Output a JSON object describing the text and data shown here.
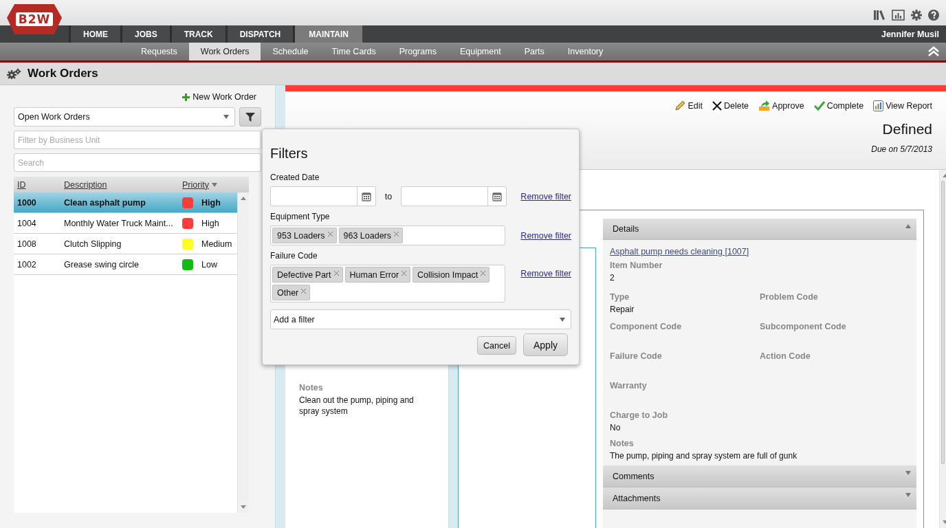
{
  "app": {
    "logo": "B2W",
    "user": "Jennifer Musil"
  },
  "main_nav": [
    {
      "label": "HOME",
      "selected": false
    },
    {
      "label": "JOBS",
      "selected": false
    },
    {
      "label": "TRACK",
      "selected": false
    },
    {
      "label": "DISPATCH",
      "selected": false
    },
    {
      "label": "MAINTAIN",
      "selected": true
    }
  ],
  "sub_nav": [
    {
      "label": "Requests",
      "selected": false
    },
    {
      "label": "Work Orders",
      "selected": true
    },
    {
      "label": "Schedule",
      "selected": false
    },
    {
      "label": "Time Cards",
      "selected": false
    },
    {
      "label": "Programs",
      "selected": false
    },
    {
      "label": "Equipment",
      "selected": false
    },
    {
      "label": "Parts",
      "selected": false
    },
    {
      "label": "Inventory",
      "selected": false
    }
  ],
  "page_title": "Work Orders",
  "list_panel": {
    "new_button": "New Work Order",
    "view_select": "Open Work Orders",
    "business_unit": {
      "placeholder": "Filter by Business Unit"
    },
    "search": {
      "placeholder": "Search"
    },
    "columns": [
      "ID",
      "Description",
      "Priority"
    ],
    "rows": [
      {
        "id": "1000",
        "description": "Clean asphalt pump",
        "priority": "High",
        "color": "#ff3b3b",
        "selected": true
      },
      {
        "id": "1004",
        "description": "Monthly Water Truck Maint...",
        "priority": "High",
        "color": "#ff3b3b",
        "selected": false
      },
      {
        "id": "1008",
        "description": "Clutch Slipping",
        "priority": "Medium",
        "color": "#ffff22",
        "selected": false
      },
      {
        "id": "1002",
        "description": "Grease swing circle",
        "priority": "Low",
        "color": "#11bb11",
        "selected": false
      }
    ]
  },
  "detail": {
    "actions": [
      {
        "kind": "edit",
        "label": "Edit"
      },
      {
        "kind": "delete",
        "label": "Delete"
      },
      {
        "kind": "approve",
        "label": "Approve"
      },
      {
        "kind": "complete",
        "label": "Complete"
      },
      {
        "kind": "report",
        "label": "View Report"
      }
    ],
    "status": "Defined",
    "due": "Due on 5/7/2013",
    "notes_label": "Notes",
    "notes": "Clean out the pump, piping and spray system",
    "details_panel": {
      "title": "Details",
      "expanded": true,
      "link": "Asphalt pump needs cleaning [1007]",
      "rows": [
        [
          {
            "label": "Item Number",
            "value": "2"
          }
        ],
        [
          {
            "label": "Type",
            "value": "Repair"
          },
          {
            "label": "Problem Code"
          }
        ],
        [
          {
            "label": "Component Code"
          },
          {
            "label": "Subcomponent Code"
          }
        ],
        [
          {
            "label": "Failure Code"
          },
          {
            "label": "Action Code"
          }
        ],
        [
          {
            "label": "Warranty"
          }
        ],
        [
          {
            "label": "Charge to Job",
            "value": "No"
          }
        ],
        [
          {
            "label": "Notes",
            "value": "The pump, piping and spray system are full of gunk"
          }
        ]
      ]
    },
    "sections": [
      {
        "title": "Comments",
        "expanded": false
      },
      {
        "title": "Attachments",
        "expanded": false
      }
    ]
  },
  "filters_dialog": {
    "title": "Filters",
    "created_date": {
      "label": "Created Date",
      "separator": "to",
      "remove": "Remove filter"
    },
    "equipment_type": {
      "label": "Equipment Type",
      "tags": [
        "953 Loaders",
        "963 Loaders"
      ],
      "remove": "Remove filter"
    },
    "failure_code": {
      "label": "Failure Code",
      "tags": [
        "Defective Part",
        "Human Error",
        "Collision Impact",
        "Other"
      ],
      "remove": "Remove filter"
    },
    "add_filter": "Add a filter",
    "cancel": "Cancel",
    "apply": "Apply"
  }
}
